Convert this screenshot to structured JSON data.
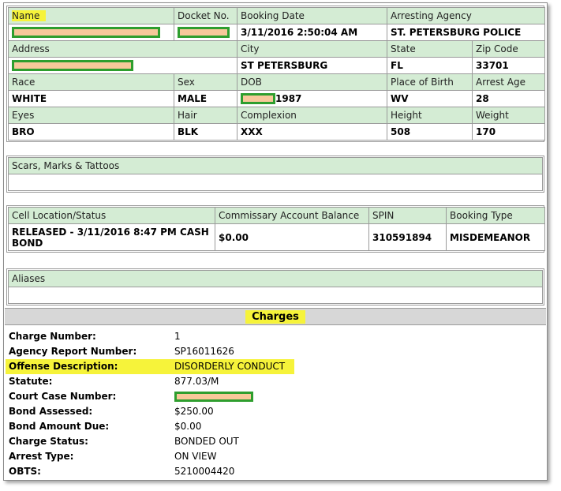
{
  "booking": {
    "labels": {
      "name": "Name",
      "docket": "Docket No.",
      "booking_date": "Booking Date",
      "arresting_agency": "Arresting Agency",
      "address": "Address",
      "city": "City",
      "state": "State",
      "zip": "Zip Code",
      "race": "Race",
      "sex": "Sex",
      "dob": "DOB",
      "place_of_birth": "Place of Birth",
      "arrest_age": "Arrest Age",
      "eyes": "Eyes",
      "hair": "Hair",
      "complexion": "Complexion",
      "height": "Height",
      "weight": "Weight"
    },
    "values": {
      "booking_date": "3/11/2016 2:50:04 AM",
      "arresting_agency": "ST. PETERSBURG POLICE",
      "city": "ST PETERSBURG",
      "state": "FL",
      "zip": "33701",
      "race": "WHITE",
      "sex": "MALE",
      "dob_year": "1987",
      "place_of_birth": "WV",
      "arrest_age": "28",
      "eyes": "BRO",
      "hair": "BLK",
      "complexion": "XXX",
      "height": "508",
      "weight": "170"
    }
  },
  "scars": {
    "label": "Scars, Marks & Tattoos",
    "value": ""
  },
  "cell": {
    "labels": {
      "cell_location": "Cell Location/Status",
      "commissary": "Commissary Account Balance",
      "spin": "SPIN",
      "booking_type": "Booking Type"
    },
    "values": {
      "cell_location": "RELEASED - 3/11/2016 8:47 PM CASH BOND",
      "commissary": "$0.00",
      "spin": "310591894",
      "booking_type": "MISDEMEANOR"
    }
  },
  "aliases": {
    "label": "Aliases",
    "value": ""
  },
  "charges": {
    "title": "Charges",
    "rows": [
      {
        "key": "Charge Number:",
        "value": "1"
      },
      {
        "key": "Agency Report Number:",
        "value": "SP16011626"
      },
      {
        "key": "Offense Description:",
        "value": "DISORDERLY CONDUCT"
      },
      {
        "key": "Statute:",
        "value": "877.03/M"
      },
      {
        "key": "Court Case Number:",
        "value": ""
      },
      {
        "key": "Bond Assessed:",
        "value": "$250.00"
      },
      {
        "key": "Bond Amount Due:",
        "value": "$0.00"
      },
      {
        "key": "Charge Status:",
        "value": "BONDED OUT"
      },
      {
        "key": "Arrest Type:",
        "value": "ON VIEW"
      },
      {
        "key": "OBTS:",
        "value": "5210004420"
      }
    ]
  },
  "colors": {
    "label_bg": "#d4ecd4",
    "highlight": "#f6f33a",
    "redaction": "#f7c89a",
    "redaction_border": "#2e9e2e"
  }
}
